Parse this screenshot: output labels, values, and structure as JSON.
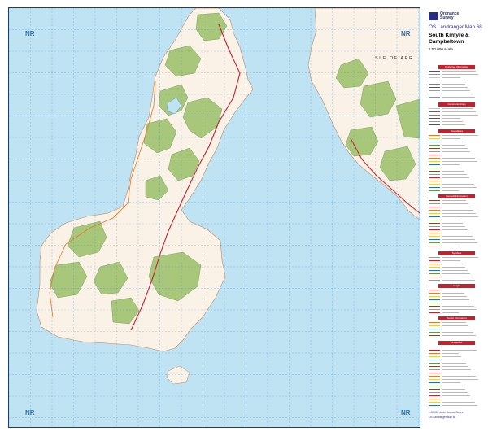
{
  "map": {
    "grid_letters": [
      "NR",
      "NR",
      "NR",
      "NR"
    ],
    "place_labels": {
      "arran": "ISLE OF ARR"
    },
    "colors": {
      "sea": "#bfe3f3",
      "land": "#fbf2e7",
      "woodland": "#a9c77a",
      "moor": "#e6eccd",
      "grid": "#3a8fd0",
      "frame": "#1a3e6e",
      "road": "#c6202f"
    }
  },
  "legend": {
    "publisher_line1": "Ordnance",
    "publisher_line2": "Survey",
    "series": "OS Landranger Map 68",
    "title_line1": "South Kintyre &",
    "title_line2": "Campbeltown",
    "scale": "1:50 000 scale",
    "sections": [
      "Customer Information",
      "Communications",
      "General Information",
      "Symbols",
      "Tourist Information",
      "Height",
      "Boundaries",
      "Antiquities"
    ],
    "footer_line1": "1:50 000 scale Second Series",
    "footer_line2": "OS Landranger Map 68",
    "icons": [
      "ordnance-survey-logo-icon"
    ]
  }
}
